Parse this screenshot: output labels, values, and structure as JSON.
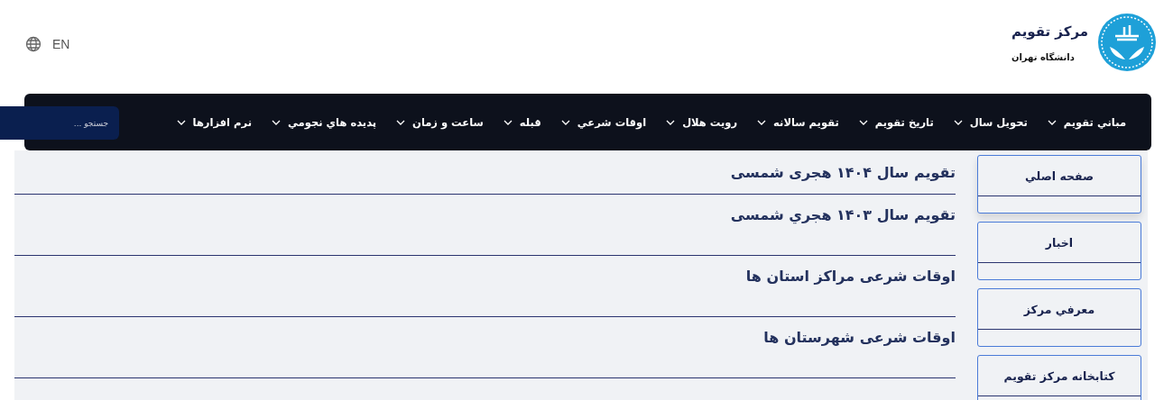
{
  "language": {
    "label": "EN"
  },
  "brand": {
    "title": "مرکز تقویم",
    "subtitle": "دانشگاه تهران"
  },
  "nav": {
    "items": [
      {
        "label": "مباني تقويم"
      },
      {
        "label": "تحويل سال"
      },
      {
        "label": "تاريخ تقويم"
      },
      {
        "label": "تقويم سالانه"
      },
      {
        "label": "رويت هلال"
      },
      {
        "label": "اوقات شرعي"
      },
      {
        "label": "قبله"
      },
      {
        "label": "ساعت و زمان"
      },
      {
        "label": "پديده هاي نجومي"
      },
      {
        "label": "نرم افزارها"
      }
    ],
    "search": {
      "placeholder": "جستجو ..."
    }
  },
  "articles": [
    {
      "title": "تقویم سال ۱۴۰۴ هجری شمسی"
    },
    {
      "title": "تقویم سال ۱۴۰۳ هجري شمسی"
    },
    {
      "title": "اوقات شرعی مراکز استان ها"
    },
    {
      "title": "اوقات شرعی شهرستان ها"
    }
  ],
  "sidebar": {
    "items": [
      {
        "label": "صفحه اصلي",
        "selected": true
      },
      {
        "label": "اخبار",
        "selected": false
      },
      {
        "label": "معرفي مرکز",
        "selected": false
      },
      {
        "label": "کتابخانه مرکز تقويم",
        "selected": false
      }
    ]
  }
}
